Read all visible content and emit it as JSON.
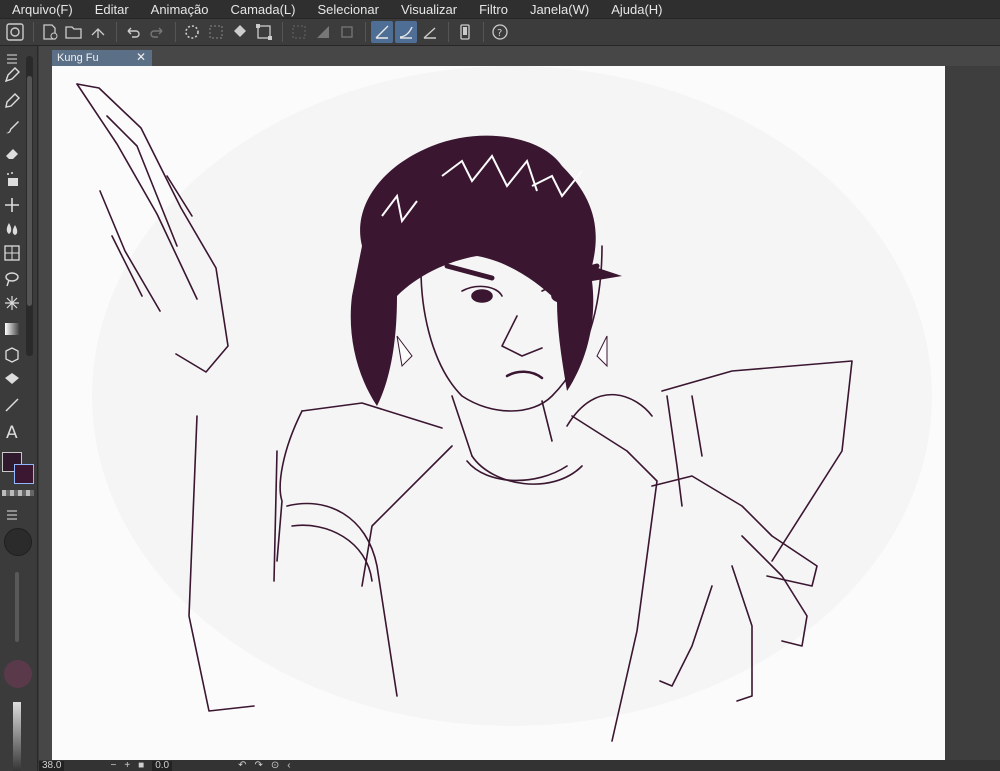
{
  "menu": [
    "Arquivo(F)",
    "Editar",
    "Animação",
    "Camada(L)",
    "Selecionar",
    "Visualizar",
    "Filtro",
    "Janela(W)",
    "Ajuda(H)"
  ],
  "tab": {
    "title": "Kung Fu",
    "close": "✕"
  },
  "status": {
    "zoom": "38.0",
    "angle": "0.0",
    "minus": "−",
    "plus": "+"
  },
  "colors": {
    "main": "#2f1a2d",
    "sub": "#3b1731",
    "line": "#3a1630"
  },
  "icons": {
    "command": [
      "clip-studio-logo-icon",
      "new-file-icon",
      "open-folder-icon",
      "save-icon",
      "undo-icon",
      "redo-icon",
      "loading-icon",
      "transform-icon",
      "fill-icon",
      "selection-icon",
      "clear-selection-icon",
      "hide-selection-icon",
      "ruler-snap-icon",
      "special-ruler-snap-icon",
      "grid-snap-icon",
      "smartphone-icon",
      "help-icon"
    ],
    "tools": [
      "pen-icon",
      "pencil-icon",
      "brush-icon",
      "eraser-icon",
      "airbrush-icon",
      "decoration-icon",
      "blend-icon",
      "frame-icon",
      "lasso-icon",
      "magic-wand-icon",
      "gradient-icon",
      "object-icon",
      "fill-bucket-icon",
      "line-icon",
      "text-icon"
    ]
  }
}
